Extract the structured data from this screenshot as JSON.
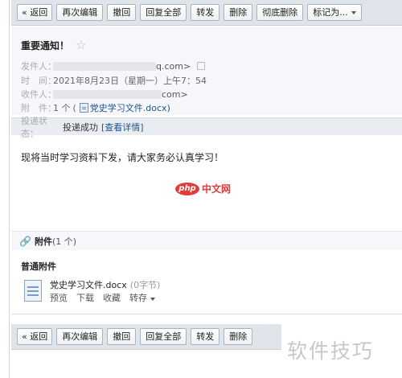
{
  "toolbar": {
    "back": "« 返回",
    "edit_again": "再次编辑",
    "recall": "撤回",
    "reply_all": "回复全部",
    "forward": "转发",
    "delete": "删除",
    "delete_permanently": "彻底删除",
    "mark_as": "标记为..."
  },
  "email": {
    "subject": "重要通知！",
    "star_icon": "☆",
    "from_label": "发件人：",
    "from_addr_tail": "q.com>",
    "time_label": "时　间：",
    "time_value": "2021年8月23日（星期一）上午7：54",
    "to_label": "收件人：",
    "to_addr_tail": "com>",
    "attachment_label": "附　件：",
    "attachment_count": "1 个",
    "attachment_filename": "党史学习文件.docx)",
    "attachment_open_paren": "(",
    "status_label": "投递状态：",
    "status_value": "投递成功",
    "status_link": "[查看详情]",
    "body": "现将当时学习资料下发，请大家务必认真学习！"
  },
  "logo": {
    "php": "php",
    "cn": "中文网"
  },
  "attachments": {
    "header_title": "附件",
    "header_count": "(1 个)",
    "section_label": "普通附件",
    "file_name": "党史学习文件.docx",
    "file_size": "(0字节)",
    "actions": [
      "预览",
      "下载",
      "收藏",
      "转存"
    ]
  },
  "bottom_toolbar": {
    "back": "« 返回",
    "edit_again": "再次编辑",
    "recall": "撤回",
    "reply_all": "回复全部",
    "forward": "转发",
    "delete": "删除"
  },
  "watermark": "软件技巧"
}
